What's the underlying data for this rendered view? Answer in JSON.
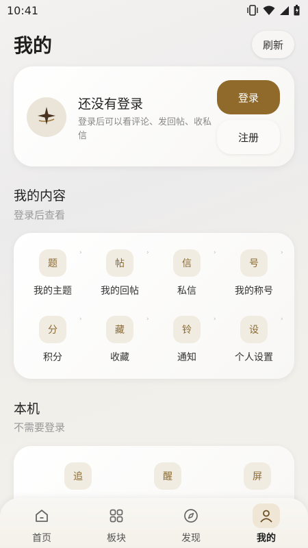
{
  "status_bar": {
    "time": "10:41",
    "icons": [
      "vibrate-icon",
      "wifi-icon",
      "signal-icon",
      "battery-icon"
    ]
  },
  "header": {
    "title": "我的",
    "refresh_label": "刷新"
  },
  "login_card": {
    "title": "还没有登录",
    "description": "登录后可以看评论、发回帖、收私信",
    "login_label": "登录",
    "register_label": "注册",
    "avatar_icon": "sparkle-logo-icon"
  },
  "my_content": {
    "title": "我的内容",
    "subtitle": "登录后查看",
    "items": [
      {
        "glyph": "题",
        "label": "我的主题"
      },
      {
        "glyph": "帖",
        "label": "我的回帖"
      },
      {
        "glyph": "信",
        "label": "私信"
      },
      {
        "glyph": "号",
        "label": "我的称号"
      },
      {
        "glyph": "分",
        "label": "积分"
      },
      {
        "glyph": "藏",
        "label": "收藏"
      },
      {
        "glyph": "铃",
        "label": "通知"
      },
      {
        "glyph": "设",
        "label": "个人设置"
      }
    ]
  },
  "local": {
    "title": "本机",
    "subtitle": "不需要登录",
    "items": [
      {
        "glyph": "追"
      },
      {
        "glyph": "醒"
      },
      {
        "glyph": "屏"
      }
    ]
  },
  "tab_bar": {
    "tabs": [
      {
        "label": "首页",
        "icon": "home-icon"
      },
      {
        "label": "板块",
        "icon": "grid-icon"
      },
      {
        "label": "发现",
        "icon": "compass-icon"
      },
      {
        "label": "我的",
        "icon": "user-icon",
        "active": true
      }
    ]
  },
  "colors": {
    "accent": "#8f6a2a",
    "icon_bg": "#f1ece2"
  }
}
